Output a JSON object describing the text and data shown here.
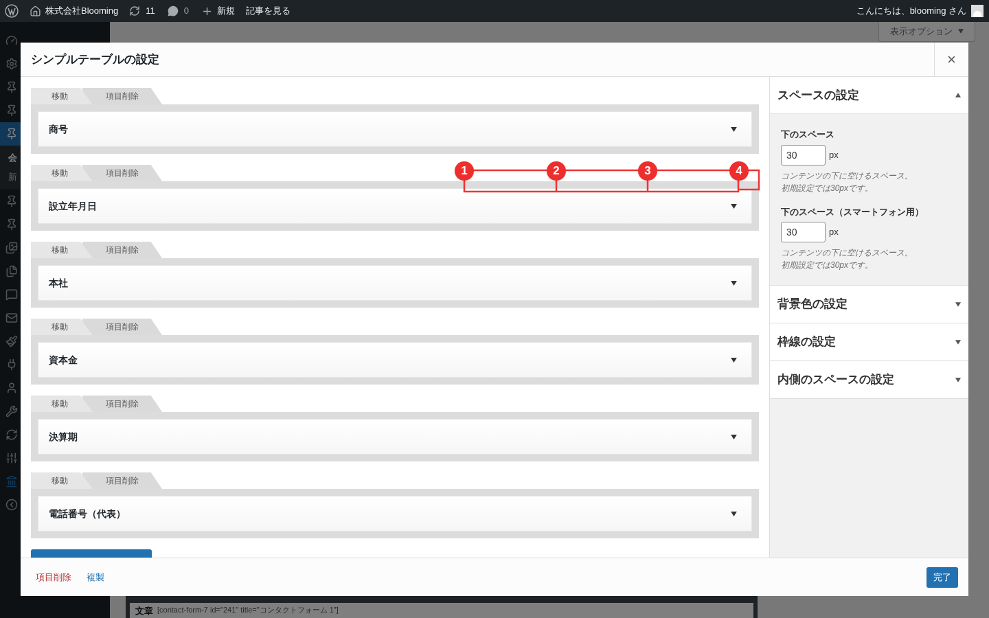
{
  "admin_bar": {
    "site_name": "株式会社Blooming",
    "updates": "11",
    "comments": "0",
    "new": "新規",
    "view_post": "記事を見る",
    "greeting": "こんにちは、blooming さん"
  },
  "sidebar": {
    "menu": [
      {
        "kind": "dashboard",
        "selected": false
      },
      {
        "kind": "settings",
        "selected": false
      },
      {
        "kind": "pin",
        "selected": false
      },
      {
        "kind": "pin",
        "selected": false
      },
      {
        "kind": "pin",
        "selected": true
      },
      {
        "kind": "pin",
        "selected": false
      },
      {
        "kind": "pin",
        "selected": false
      },
      {
        "kind": "media",
        "selected": false
      },
      {
        "kind": "pages",
        "selected": false
      },
      {
        "kind": "comments",
        "selected": false
      },
      {
        "kind": "mail",
        "selected": false
      },
      {
        "kind": "brush",
        "selected": false
      },
      {
        "kind": "plugin",
        "selected": false
      },
      {
        "kind": "user",
        "selected": false
      },
      {
        "kind": "tools",
        "selected": false
      },
      {
        "kind": "refresh",
        "selected": false
      },
      {
        "kind": "sliders",
        "selected": false
      },
      {
        "kind": "building",
        "selected": false
      },
      {
        "kind": "collapse",
        "selected": false
      }
    ],
    "submenu": [
      "会",
      "新"
    ]
  },
  "page": {
    "screen_options": "表示オプション",
    "box_label": "文章",
    "shortcode": "[contact-form-7 id=\"241\" title=\"コンタクトフォーム 1\"]"
  },
  "modal": {
    "title": "シンプルテーブルの設定",
    "close": "×",
    "items": [
      {
        "move": "移動",
        "delete": "項目削除",
        "label": "商号"
      },
      {
        "move": "移動",
        "delete": "項目削除",
        "label": "設立年月日"
      },
      {
        "move": "移動",
        "delete": "項目削除",
        "label": "本社"
      },
      {
        "move": "移動",
        "delete": "項目削除",
        "label": "資本金"
      },
      {
        "move": "移動",
        "delete": "項目削除",
        "label": "決算期"
      },
      {
        "move": "移動",
        "delete": "項目削除",
        "label": "電話番号（代表）"
      }
    ],
    "annotations": [
      "1",
      "2",
      "3",
      "4"
    ],
    "panel": [
      {
        "title": "スペースの設定",
        "expanded": true,
        "fields": [
          {
            "label": "下のスペース",
            "value": "30",
            "unit": "px",
            "help": [
              "コンテンツの下に空けるスペース。",
              "初期設定では30pxです。"
            ]
          },
          {
            "label": "下のスペース（スマートフォン用）",
            "value": "30",
            "unit": "px",
            "help": [
              "コンテンツの下に空けるスペース。",
              "初期設定では30pxです。"
            ]
          }
        ]
      },
      {
        "title": "背景色の設定",
        "expanded": false
      },
      {
        "title": "枠線の設定",
        "expanded": false
      },
      {
        "title": "内側のスペースの設定",
        "expanded": false
      }
    ],
    "footer": {
      "delete": "項目削除",
      "duplicate": "複製",
      "done": "完了"
    }
  }
}
